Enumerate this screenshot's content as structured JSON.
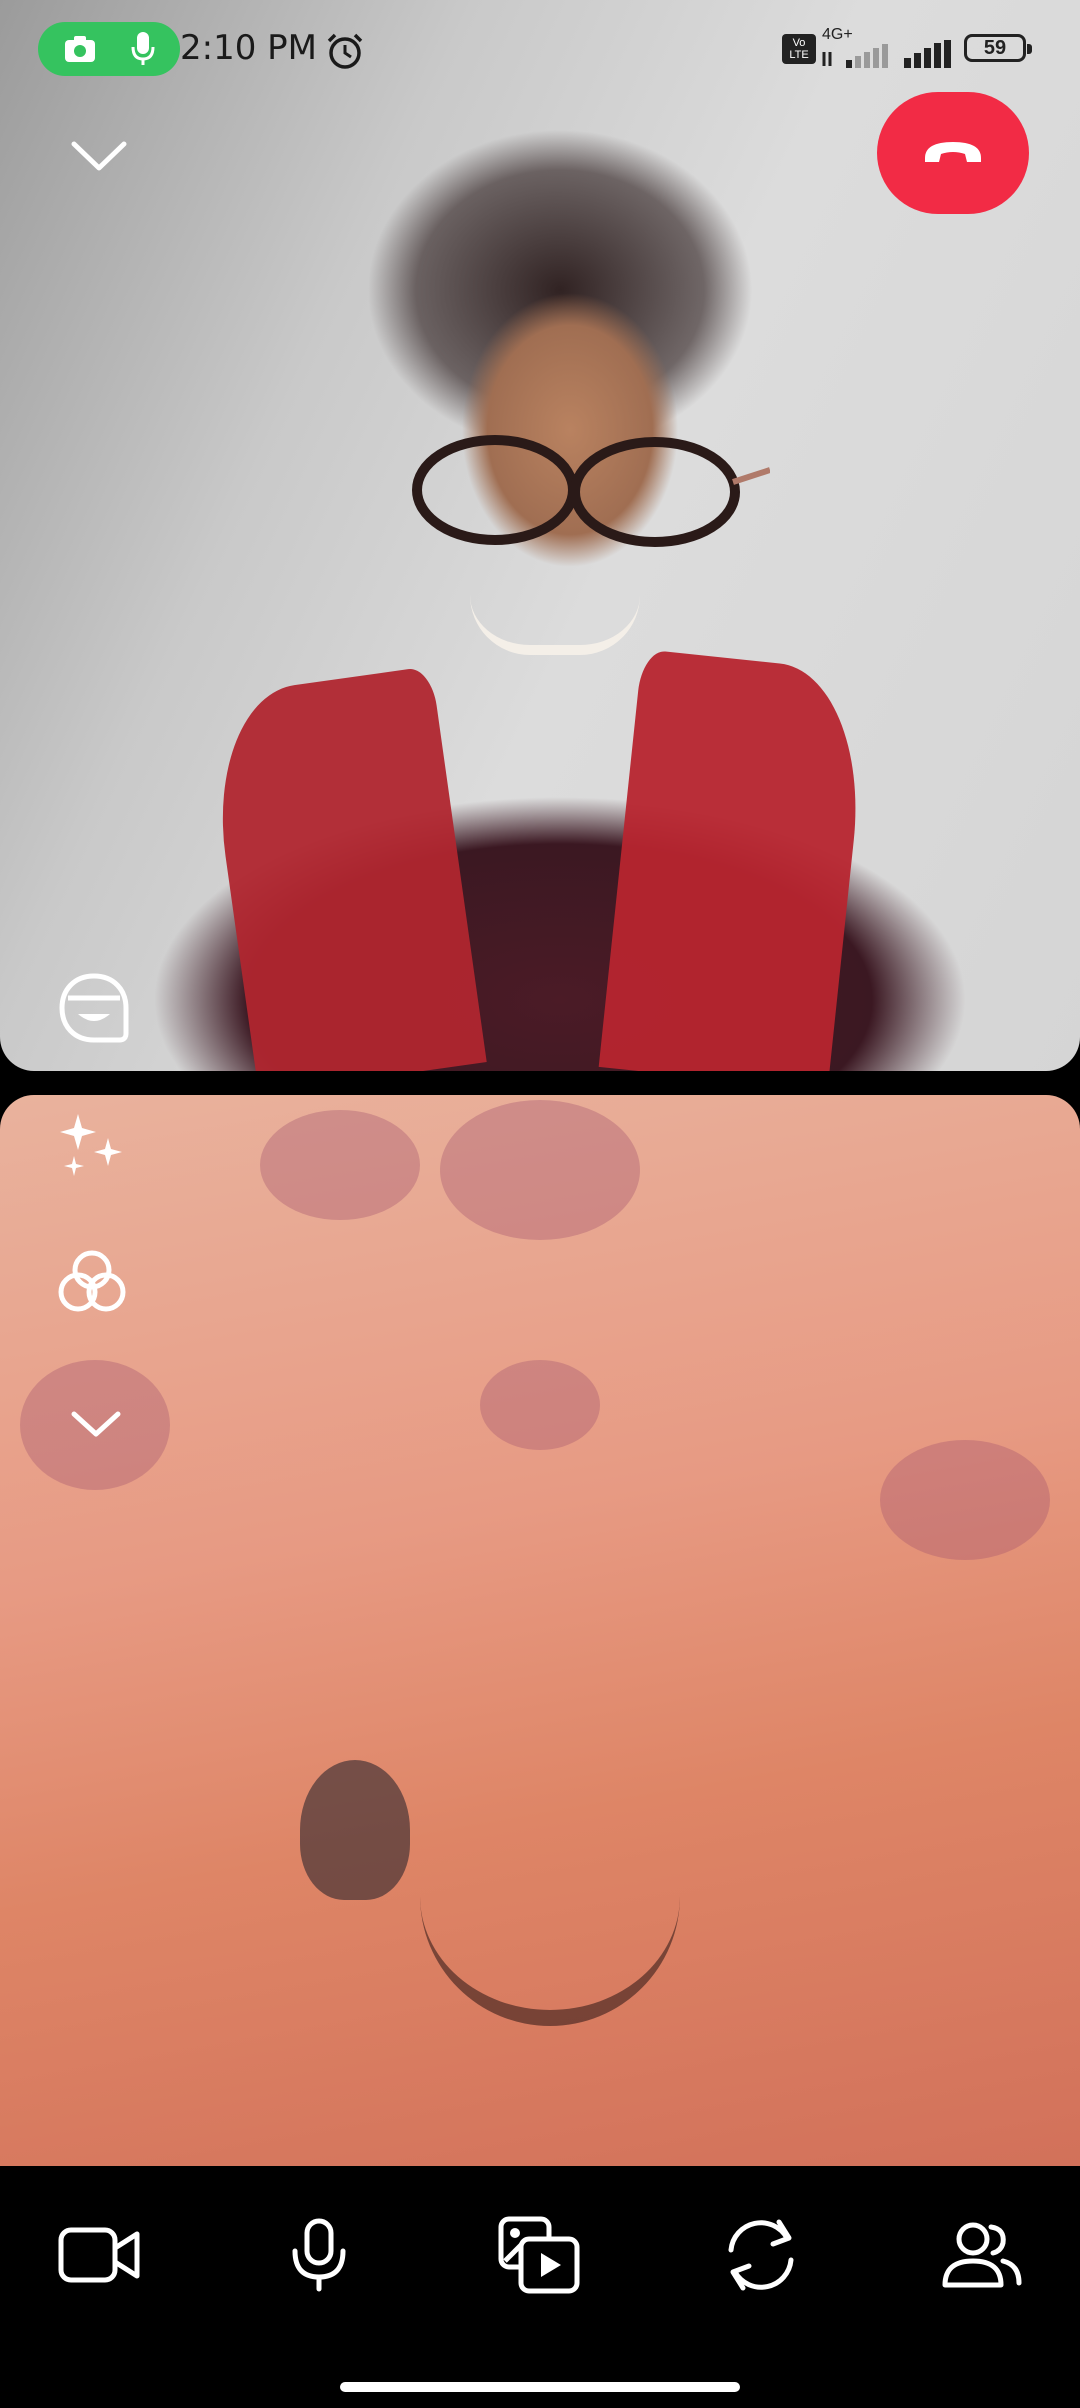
{
  "status_bar": {
    "time": "2:10 PM",
    "volte_label": "Vo LTE",
    "network_label": "4G+",
    "battery_level": "59",
    "recording_icons": [
      "camera-icon",
      "microphone-icon"
    ],
    "alarm_icon": "alarm-icon"
  },
  "call": {
    "end_call_icon": "phone-hangup-icon",
    "end_call_color": "#f22b45",
    "minimize_icon": "chevron-down-icon",
    "remote_tile_icon": "avatar-sticker-icon"
  },
  "local_tile": {
    "side_tools": [
      "sparkles-effects-icon",
      "color-filters-icon",
      "chevron-down-icon"
    ]
  },
  "toolbar": {
    "items": [
      {
        "icon": "video-camera-icon"
      },
      {
        "icon": "microphone-icon"
      },
      {
        "icon": "media-share-icon"
      },
      {
        "icon": "flip-camera-icon"
      },
      {
        "icon": "participants-icon"
      }
    ]
  },
  "colors": {
    "recording_pill": "#35c35f",
    "toolbar_background": "#000000",
    "icon_color": "#ffffff"
  }
}
